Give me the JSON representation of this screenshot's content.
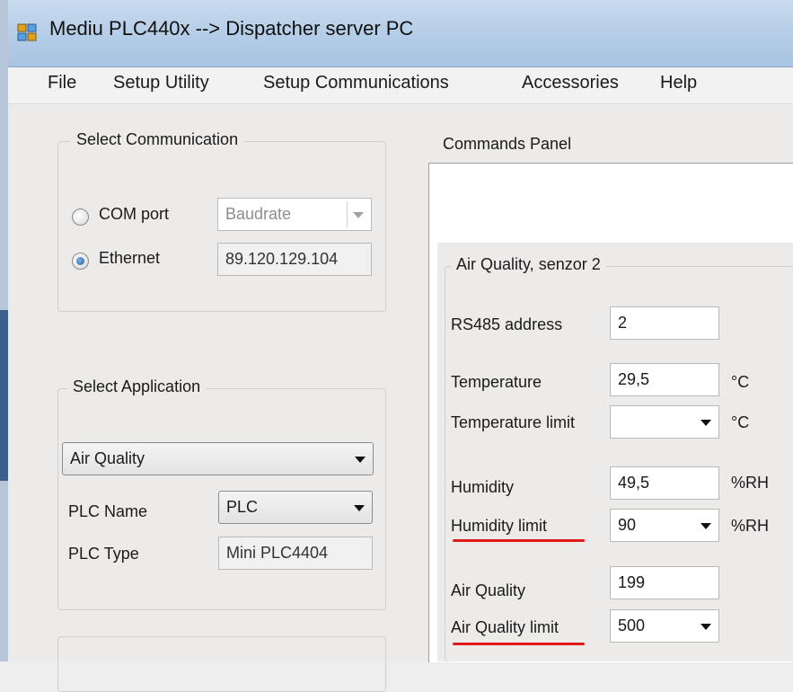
{
  "window": {
    "title": "Mediu PLC440x --> Dispatcher server PC"
  },
  "menu": [
    "File",
    "Setup Utility",
    "Setup Communications",
    "Accessories",
    "Help"
  ],
  "select_communication": {
    "label": "Select Communication",
    "com_port": {
      "label": "COM port",
      "selected": false,
      "baudrate_placeholder": "Baudrate"
    },
    "ethernet": {
      "label": "Ethernet",
      "selected": true,
      "ip": "89.120.129.104"
    }
  },
  "select_application": {
    "label": "Select Application",
    "application": "Air Quality",
    "plc_name_label": "PLC Name",
    "plc_name": "PLC",
    "plc_type_label": "PLC Type",
    "plc_type": "Mini PLC4404"
  },
  "commands_panel": {
    "label": "Commands Panel"
  },
  "sensor": {
    "label": "Air Quality, senzor 2",
    "rs485_label": "RS485 address",
    "rs485_value": "2",
    "temperature_label": "Temperature",
    "temperature_value": "29,5",
    "temperature_unit": "°C",
    "temperature_limit_label": "Temperature limit",
    "temperature_limit_value": "",
    "temperature_limit_unit": "°C",
    "humidity_label": "Humidity",
    "humidity_value": "49,5",
    "humidity_unit": "%RH",
    "humidity_limit_label": "Humidity limit",
    "humidity_limit_value": "90",
    "humidity_limit_unit": "%RH",
    "air_quality_label": "Air Quality",
    "air_quality_value": "199",
    "air_quality_limit_label": "Air Quality limit",
    "air_quality_limit_value": "500"
  },
  "colors": {
    "highlight": "#e11b1b",
    "titlebar": "#b4cce6"
  }
}
